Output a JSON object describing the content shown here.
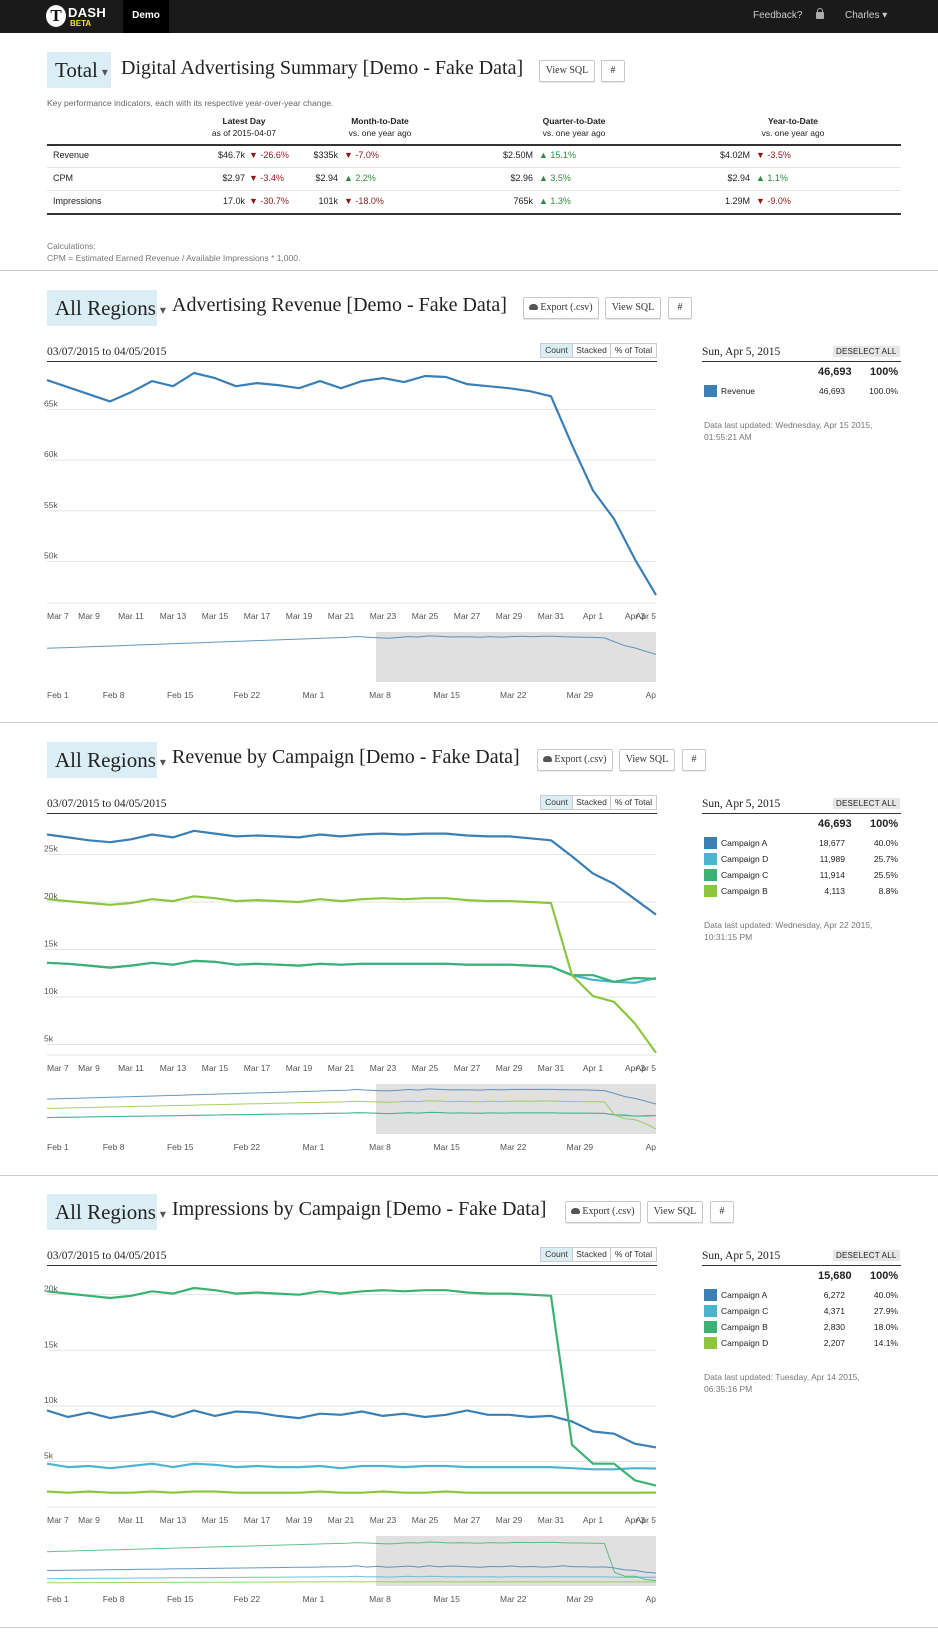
{
  "nav": {
    "logo_text": "DASH",
    "logo_beta": "BETA",
    "demo_tab": "Demo",
    "feedback": "Feedback?",
    "user": "Charles ▾"
  },
  "summary": {
    "segment": "Total",
    "title": "Digital Advertising Summary [Demo - Fake Data]",
    "view_sql": "View SQL",
    "hash": "#",
    "description": "Key performance indicators, each with its respective year-over-year change.",
    "columns": [
      {
        "title": "Latest Day",
        "sub": "as of 2015-04-07"
      },
      {
        "title": "Month-to-Date",
        "sub": "vs. one year ago"
      },
      {
        "title": "Quarter-to-Date",
        "sub": "vs. one year ago"
      },
      {
        "title": "Year-to-Date",
        "sub": "vs. one year ago"
      }
    ],
    "rows": [
      {
        "label": "Revenue",
        "cells": [
          {
            "value": "$46.7k",
            "dir": "down",
            "change": "-26.6%"
          },
          {
            "value": "$335k",
            "dir": "down",
            "change": "-7.0%"
          },
          {
            "value": "$2.50M",
            "dir": "up",
            "change": "15.1%"
          },
          {
            "value": "$4.02M",
            "dir": "down",
            "change": "-3.5%"
          }
        ]
      },
      {
        "label": "CPM",
        "cells": [
          {
            "value": "$2.97",
            "dir": "down",
            "change": "-3.4%"
          },
          {
            "value": "$2.94",
            "dir": "up",
            "change": "2.2%"
          },
          {
            "value": "$2.96",
            "dir": "up",
            "change": "3.5%"
          },
          {
            "value": "$2.94",
            "dir": "up",
            "change": "1.1%"
          }
        ]
      },
      {
        "label": "Impressions",
        "cells": [
          {
            "value": "17.0k",
            "dir": "down",
            "change": "-30.7%"
          },
          {
            "value": "101k",
            "dir": "down",
            "change": "-18.0%"
          },
          {
            "value": "765k",
            "dir": "up",
            "change": "1.3%"
          },
          {
            "value": "1.29M",
            "dir": "down",
            "change": "-9.0%"
          }
        ]
      }
    ],
    "calc_title": "Calculations:",
    "calc_formula": "CPM = Estimated Earned Revenue / Available Impressions * 1,000."
  },
  "ui": {
    "export": "Export (.csv)",
    "view_sql": "View SQL",
    "hash": "#",
    "count": "Count",
    "stacked": "Stacked",
    "pct_total": "% of Total",
    "deselect": "DESELECT ALL",
    "range": "03/07/2015 to 04/05/2015",
    "side_date": "Sun, Apr 5, 2015",
    "total_pct": "100%"
  },
  "chart_data": [
    {
      "type": "line",
      "segment": "All Regions",
      "title": "Advertising Revenue [Demo - Fake Data]",
      "x_labels": [
        "Mar 7",
        "Mar 9",
        "Mar 11",
        "Mar 13",
        "Mar 15",
        "Mar 17",
        "Mar 19",
        "Mar 21",
        "Mar 23",
        "Mar 25",
        "Mar 27",
        "Mar 29",
        "Mar 31",
        "Apr 1",
        "Apr 3",
        "Apr 5"
      ],
      "x_dates": [
        "2015-03-07",
        "2015-03-08",
        "2015-03-09",
        "2015-03-10",
        "2015-03-11",
        "2015-03-12",
        "2015-03-13",
        "2015-03-14",
        "2015-03-15",
        "2015-03-16",
        "2015-03-17",
        "2015-03-18",
        "2015-03-19",
        "2015-03-20",
        "2015-03-21",
        "2015-03-22",
        "2015-03-23",
        "2015-03-24",
        "2015-03-25",
        "2015-03-26",
        "2015-03-27",
        "2015-03-28",
        "2015-03-29",
        "2015-03-30",
        "2015-03-31",
        "2015-04-01",
        "2015-04-02",
        "2015-04-03",
        "2015-04-04",
        "2015-04-05"
      ],
      "y_ticks": [
        "65k",
        "60k",
        "55k",
        "50k"
      ],
      "ylim": [
        46000,
        68500
      ],
      "series": [
        {
          "name": "Revenue",
          "color": "#3a7fb5",
          "values": [
            67900,
            67200,
            66500,
            65800,
            66700,
            67800,
            67300,
            68600,
            68100,
            67300,
            67600,
            67400,
            67100,
            67800,
            67100,
            67800,
            68100,
            67700,
            68300,
            68200,
            67500,
            67300,
            67100,
            66800,
            66300,
            61500,
            57000,
            54200,
            50200,
            46693
          ]
        }
      ],
      "brush_labels": [
        "Feb 1",
        "Feb 8",
        "Feb 15",
        "Feb 22",
        "Mar 1",
        "Mar 8",
        "Mar 15",
        "Mar 22",
        "Mar 29",
        "Ap"
      ],
      "legend": {
        "total": "46,693",
        "items": [
          {
            "name": "Revenue",
            "value": "46,693",
            "pct": "100.0%",
            "color": "#3a7fb5"
          }
        ]
      },
      "updated": [
        "Data last updated: Wednesday, Apr 15 2015,",
        "01:55:21 AM"
      ]
    },
    {
      "type": "line",
      "segment": "All Regions",
      "title": "Revenue by Campaign [Demo - Fake Data]",
      "x_labels": [
        "Mar 7",
        "Mar 9",
        "Mar 11",
        "Mar 13",
        "Mar 15",
        "Mar 17",
        "Mar 19",
        "Mar 21",
        "Mar 23",
        "Mar 25",
        "Mar 27",
        "Mar 29",
        "Mar 31",
        "Apr 1",
        "Apr 3",
        "Apr 5"
      ],
      "y_ticks": [
        "25k",
        "20k",
        "15k",
        "10k",
        "5k"
      ],
      "ylim": [
        4000,
        28000
      ],
      "series": [
        {
          "name": "Campaign A",
          "color": "#3a7fb5",
          "values": [
            27100,
            26800,
            26500,
            26300,
            26600,
            27100,
            26800,
            27500,
            27200,
            26900,
            27000,
            26900,
            26800,
            27100,
            26900,
            27100,
            27200,
            27100,
            27200,
            27200,
            27000,
            26900,
            26900,
            26700,
            26500,
            24800,
            23000,
            21900,
            20300,
            18677
          ]
        },
        {
          "name": "Campaign D",
          "color": "#4ab5cc",
          "values": [
            13600,
            13500,
            13300,
            13100,
            13300,
            13600,
            13400,
            13800,
            13700,
            13400,
            13500,
            13400,
            13300,
            13500,
            13400,
            13500,
            13500,
            13500,
            13500,
            13500,
            13400,
            13400,
            13400,
            13300,
            13200,
            12300,
            11800,
            11600,
            11500,
            11989
          ]
        },
        {
          "name": "Campaign C",
          "color": "#3bb273",
          "values": [
            13600,
            13500,
            13300,
            13100,
            13300,
            13600,
            13400,
            13800,
            13700,
            13400,
            13500,
            13400,
            13300,
            13500,
            13400,
            13500,
            13500,
            13500,
            13500,
            13500,
            13400,
            13400,
            13400,
            13300,
            13200,
            12300,
            12300,
            11600,
            12000,
            11914
          ]
        },
        {
          "name": "Campaign B",
          "color": "#8cc63f",
          "values": [
            20300,
            20100,
            19900,
            19700,
            19900,
            20300,
            20100,
            20600,
            20400,
            20100,
            20200,
            20100,
            20000,
            20300,
            20100,
            20300,
            20400,
            20300,
            20400,
            20400,
            20200,
            20100,
            20100,
            20000,
            19900,
            12300,
            10100,
            9500,
            7200,
            4113
          ]
        }
      ],
      "brush_labels": [
        "Feb 1",
        "Feb 8",
        "Feb 15",
        "Feb 22",
        "Mar 1",
        "Mar 8",
        "Mar 15",
        "Mar 22",
        "Mar 29",
        "Ap"
      ],
      "legend": {
        "total": "46,693",
        "items": [
          {
            "name": "Campaign A",
            "value": "18,677",
            "pct": "40.0%",
            "color": "#3a7fb5"
          },
          {
            "name": "Campaign D",
            "value": "11,989",
            "pct": "25.7%",
            "color": "#4ab5cc"
          },
          {
            "name": "Campaign C",
            "value": "11,914",
            "pct": "25.5%",
            "color": "#3bb273"
          },
          {
            "name": "Campaign B",
            "value": "4,113",
            "pct": "8.8%",
            "color": "#8cc63f"
          }
        ]
      },
      "updated": [
        "Data last updated: Wednesday, Apr 22 2015,",
        "10:31:15 PM"
      ]
    },
    {
      "type": "line",
      "segment": "All Regions",
      "title": "Impressions by Campaign [Demo - Fake Data]",
      "x_labels": [
        "Mar 7",
        "Mar 9",
        "Mar 11",
        "Mar 13",
        "Mar 15",
        "Mar 17",
        "Mar 19",
        "Mar 21",
        "Mar 23",
        "Mar 25",
        "Mar 27",
        "Mar 29",
        "Mar 31",
        "Apr 1",
        "Apr 3",
        "Apr 5"
      ],
      "y_ticks": [
        "20k",
        "15k",
        "10k",
        "5k"
      ],
      "ylim": [
        1000,
        21500
      ],
      "series": [
        {
          "name": "Campaign A",
          "color": "#3a7fb5",
          "values": [
            9600,
            9000,
            9400,
            8900,
            9200,
            9500,
            9000,
            9600,
            9100,
            9500,
            9400,
            9100,
            8900,
            9300,
            9200,
            9500,
            9100,
            9300,
            9000,
            9200,
            9600,
            9200,
            9200,
            9000,
            9100,
            8600,
            7700,
            7500,
            6600,
            6272
          ]
        },
        {
          "name": "Campaign C",
          "color": "#4ab5cc",
          "values": [
            4800,
            4500,
            4600,
            4400,
            4600,
            4800,
            4500,
            4800,
            4700,
            4500,
            4600,
            4500,
            4500,
            4600,
            4400,
            4600,
            4600,
            4500,
            4600,
            4600,
            4500,
            4500,
            4500,
            4500,
            4500,
            4400,
            4300,
            4300,
            4400,
            4371
          ]
        },
        {
          "name": "Campaign B",
          "color": "#3bb273",
          "values": [
            20300,
            20100,
            19900,
            19700,
            19900,
            20300,
            20100,
            20600,
            20400,
            20100,
            20200,
            20100,
            20000,
            20300,
            20100,
            20300,
            20400,
            20300,
            20400,
            20400,
            20200,
            20100,
            20100,
            20000,
            19900,
            6500,
            4800,
            4800,
            3300,
            2830
          ]
        },
        {
          "name": "Campaign D",
          "color": "#8cc63f",
          "values": [
            2300,
            2200,
            2300,
            2200,
            2200,
            2300,
            2200,
            2300,
            2300,
            2200,
            2200,
            2200,
            2200,
            2300,
            2200,
            2200,
            2300,
            2200,
            2200,
            2300,
            2200,
            2200,
            2200,
            2200,
            2200,
            2200,
            2200,
            2200,
            2200,
            2207
          ]
        }
      ],
      "brush_labels": [
        "Feb 1",
        "Feb 8",
        "Feb 15",
        "Feb 22",
        "Mar 1",
        "Mar 8",
        "Mar 15",
        "Mar 22",
        "Mar 29",
        "Ap"
      ],
      "legend": {
        "total": "15,680",
        "items": [
          {
            "name": "Campaign A",
            "value": "6,272",
            "pct": "40.0%",
            "color": "#3a7fb5"
          },
          {
            "name": "Campaign C",
            "value": "4,371",
            "pct": "27.9%",
            "color": "#4ab5cc"
          },
          {
            "name": "Campaign B",
            "value": "2,830",
            "pct": "18.0%",
            "color": "#3bb273"
          },
          {
            "name": "Campaign D",
            "value": "2,207",
            "pct": "14.1%",
            "color": "#8cc63f"
          }
        ]
      },
      "updated": [
        "Data last updated: Tuesday, Apr 14 2015,",
        "06:35:16 PM"
      ]
    }
  ]
}
